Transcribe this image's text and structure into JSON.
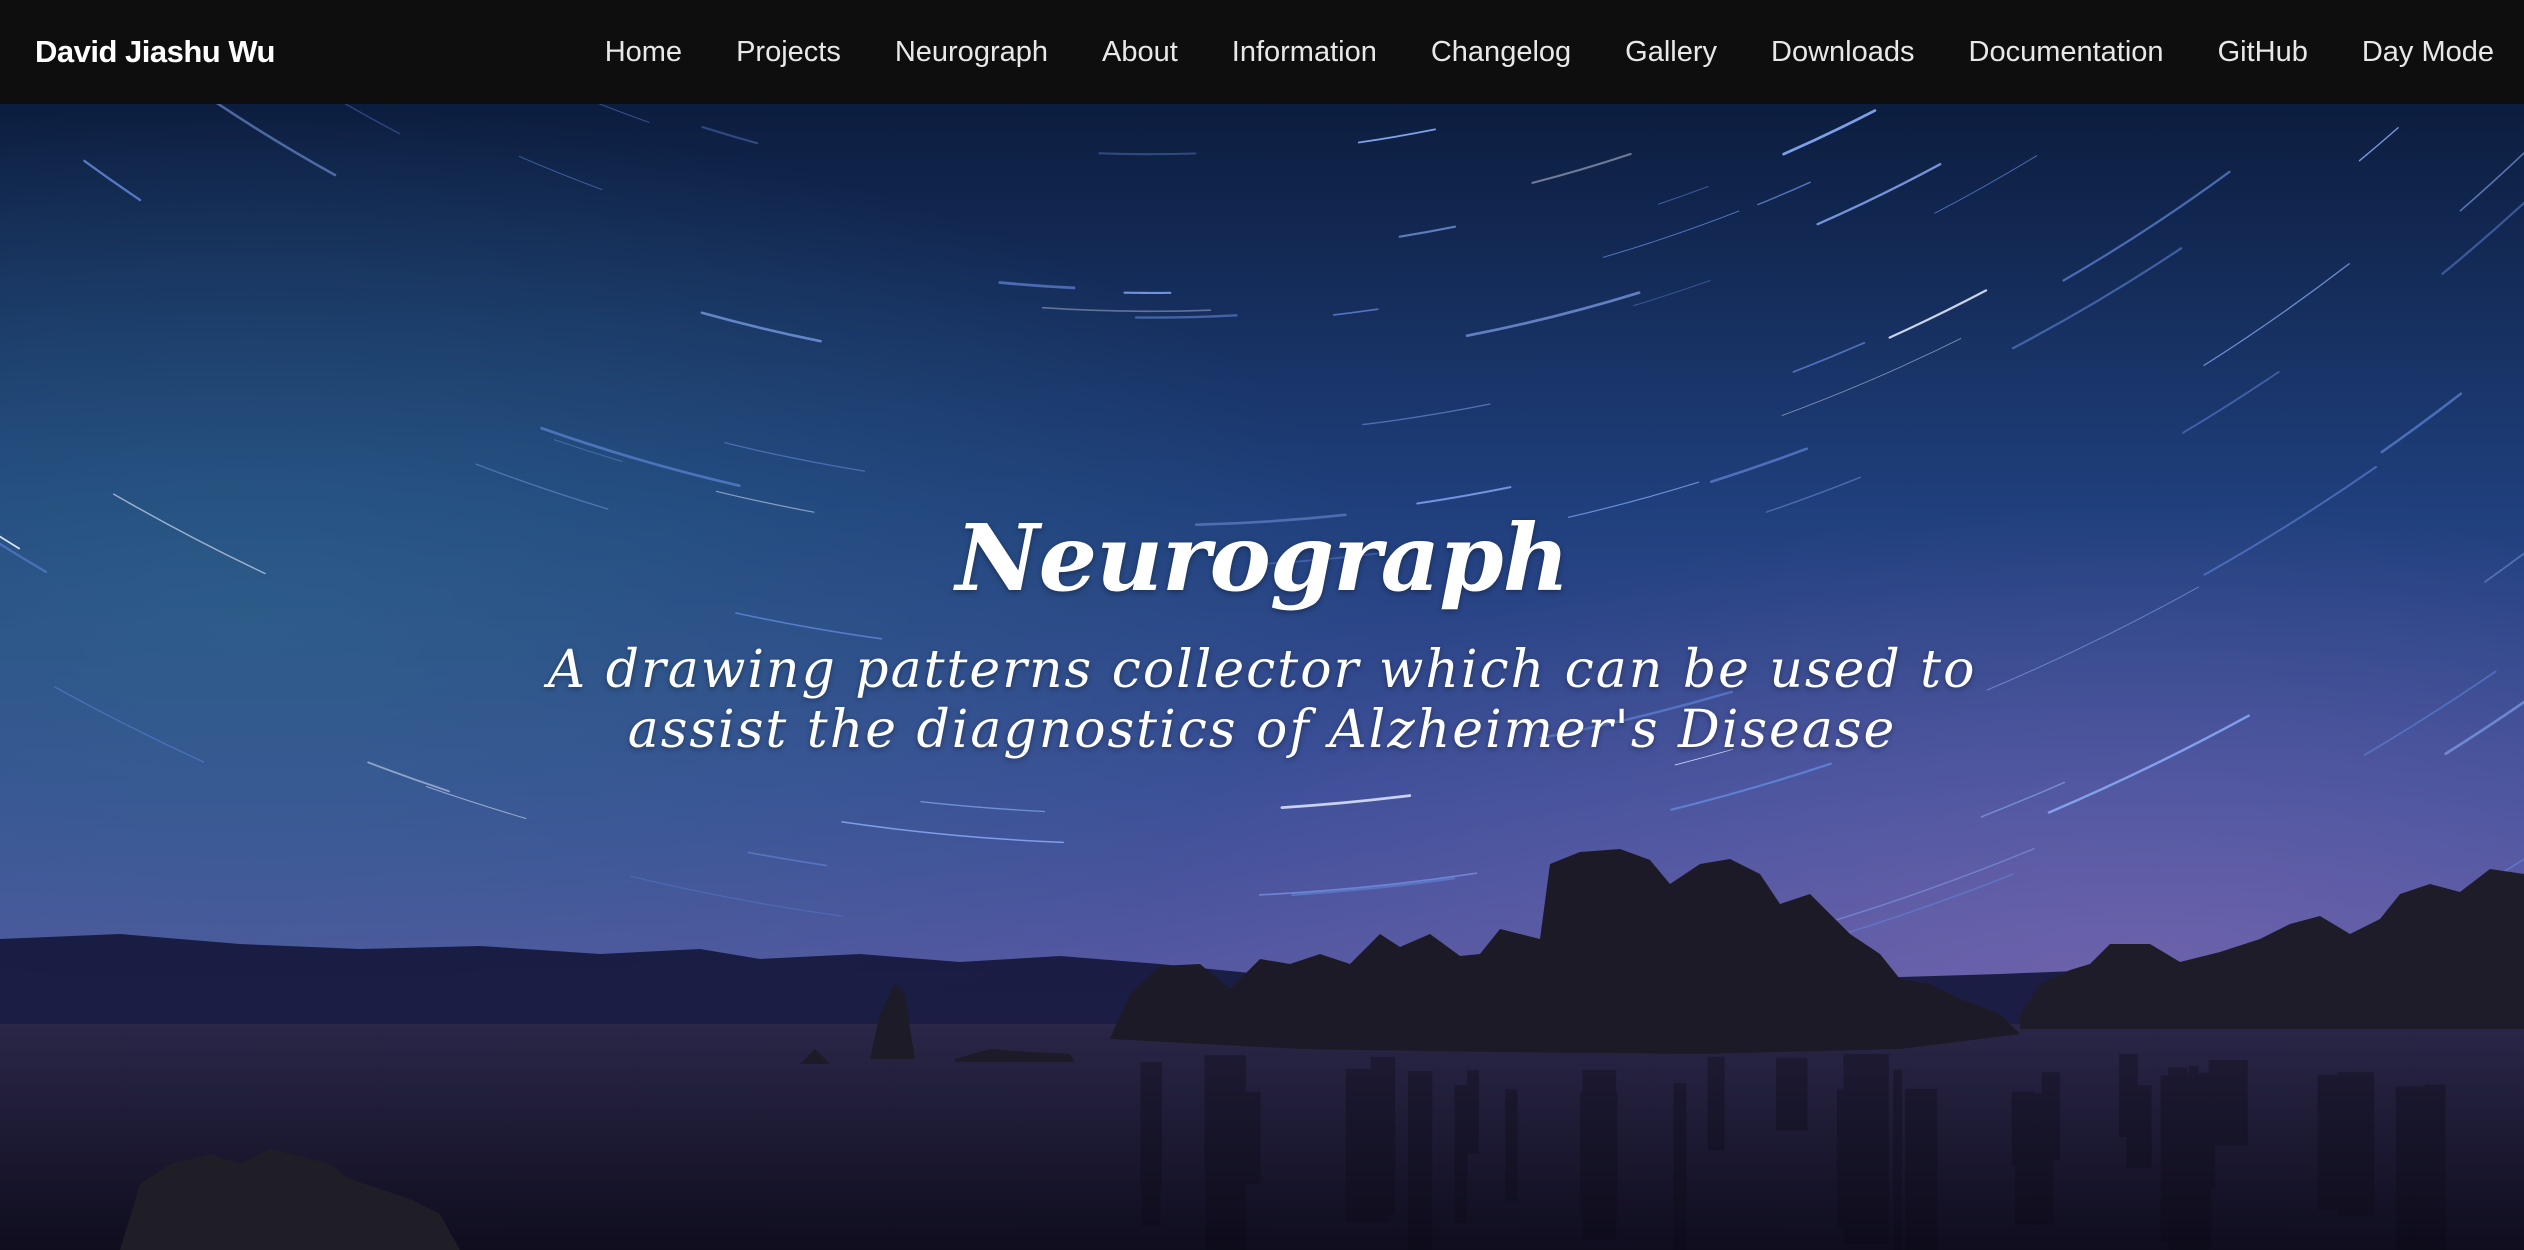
{
  "header": {
    "brand": "David Jiashu Wu",
    "nav": [
      {
        "label": "Home",
        "name": "nav-home"
      },
      {
        "label": "Projects",
        "name": "nav-projects"
      },
      {
        "label": "Neurograph",
        "name": "nav-neurograph"
      },
      {
        "label": "About",
        "name": "nav-about"
      },
      {
        "label": "Information",
        "name": "nav-information"
      },
      {
        "label": "Changelog",
        "name": "nav-changelog"
      },
      {
        "label": "Gallery",
        "name": "nav-gallery"
      },
      {
        "label": "Downloads",
        "name": "nav-downloads"
      },
      {
        "label": "Documentation",
        "name": "nav-documentation"
      },
      {
        "label": "GitHub",
        "name": "nav-github"
      },
      {
        "label": "Day Mode",
        "name": "nav-day-mode"
      }
    ]
  },
  "hero": {
    "title": "Neurograph",
    "subtitle": "A drawing patterns collector which can be used to assist the diagnostics of Alzheimer's Disease",
    "background": "night-sky-star-trails-lake-image"
  },
  "colors": {
    "navbar_bg": "#0e0e0e",
    "nav_text": "#e8e8e8",
    "sky_top": "#0d1f3f",
    "sky_mid": "#2b4f95",
    "sky_low": "#5a5aa3",
    "water": "#1a1730"
  }
}
